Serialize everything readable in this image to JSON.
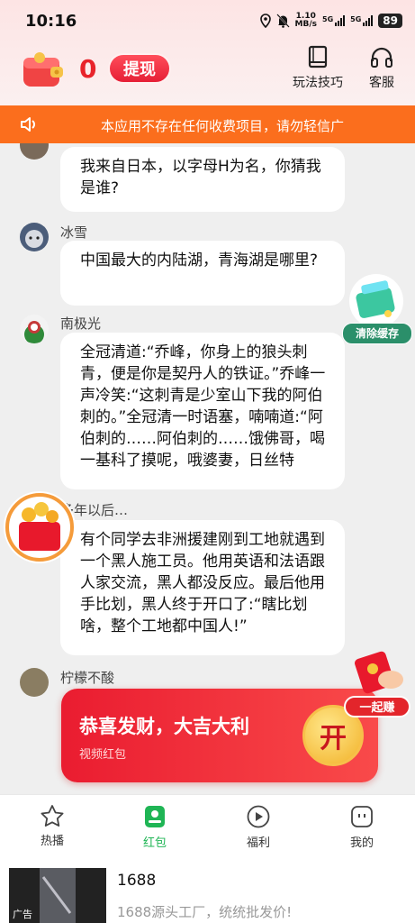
{
  "status": {
    "time": "10:16",
    "net_speed_value": "1.10",
    "net_speed_unit": "MB/s",
    "sig1": "5G",
    "sig2": "5G",
    "battery": "89"
  },
  "header": {
    "coin_balance": "0",
    "withdraw_label": "提现",
    "tips_label": "玩法技巧",
    "service_label": "客服"
  },
  "notice": {
    "text": "本应用不存在任何收费项目，请勿轻信广"
  },
  "messages": [
    {
      "user": "",
      "text": "我来自日本，以字母H为名，你猜我是谁?"
    },
    {
      "user": "冰雪",
      "text": "中国最大的内陆湖，青海湖是哪里?"
    },
    {
      "user": "南极光",
      "text": "全冠清道:“乔峰，你身上的狼头刺青，便是你是契丹人的铁证。”乔峰一声冷笑:“这刺青是少室山下我的阿伯刺的。”全冠清一时语塞，喃喃道:“阿伯刺的……阿伯刺的……饿佛哥，喝一基科了摸呢，哦婆妻，日丝特"
    },
    {
      "user": "多年以后…",
      "text": "有个同学去非洲援建刚到工地就遇到一个黑人施工员。他用英语和法语跟人家交流，黑人都没反应。最后他用手比划，黑人终于开口了:“瞎比划啥，整个工地都中国人!”"
    },
    {
      "user": "柠檬不酸",
      "text": ""
    }
  ],
  "red_packet": {
    "title": "恭喜发财，大吉大利",
    "subtitle": "视频红包",
    "open_label": "开"
  },
  "floating": {
    "clear_cache": "清除缓存",
    "together_earn": "一起赚"
  },
  "tabs": [
    {
      "label": "热播",
      "icon": "star-icon"
    },
    {
      "label": "红包",
      "icon": "redpacket-icon"
    },
    {
      "label": "福利",
      "icon": "play-icon"
    },
    {
      "label": "我的",
      "icon": "profile-icon"
    }
  ],
  "ad": {
    "tag": "广告",
    "title": "1688",
    "description": "1688源头工厂，统统批发价!"
  },
  "colors": {
    "accent_red": "#e8242b",
    "notice_orange": "#fb6e1d",
    "tab_active_green": "#1fb555"
  }
}
